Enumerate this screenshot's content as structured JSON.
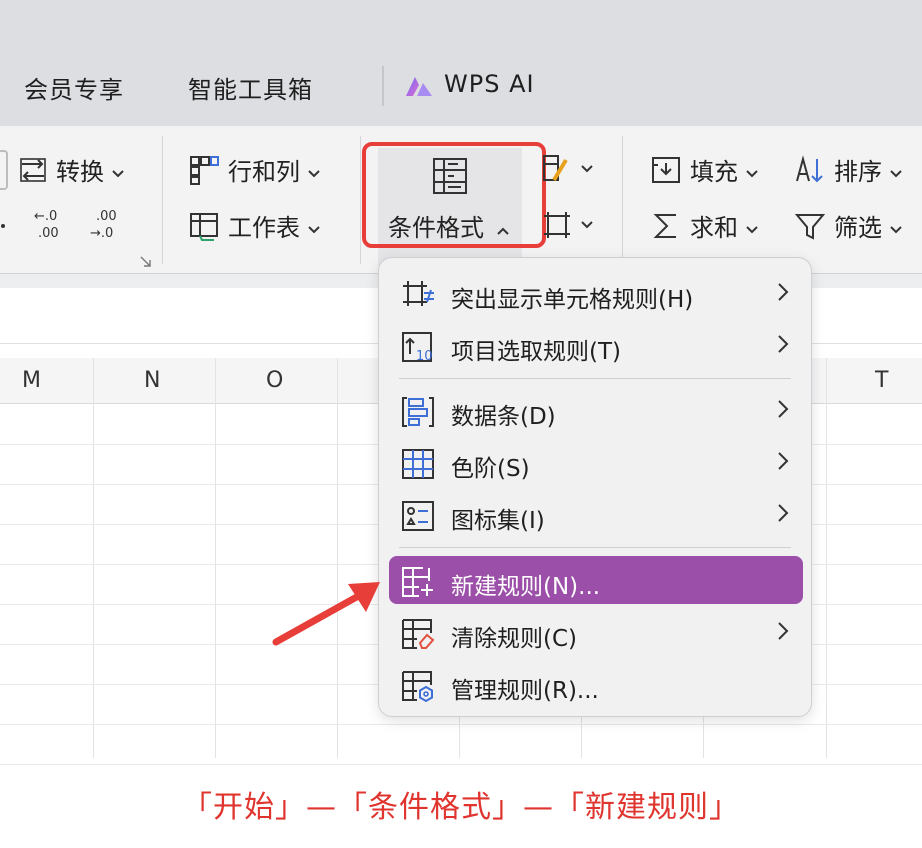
{
  "tabs": {
    "member": "会员专享",
    "smart_tools": "智能工具箱",
    "wps_ai": "WPS AI"
  },
  "ribbon": {
    "convert": "转换",
    "rows_cols": "行和列",
    "worksheet": "工作表",
    "cond_format": "条件格式",
    "fill": "填充",
    "sort": "排序",
    "sum": "求和",
    "filter": "筛选"
  },
  "columns": [
    "M",
    "N",
    "O",
    "T"
  ],
  "menu": {
    "highlight_rules": "突出显示单元格规则(H)",
    "top_rules": "项目选取规则(T)",
    "data_bars": "数据条(D)",
    "color_scales": "色阶(S)",
    "icon_sets": "图标集(I)",
    "new_rule": "新建规则(N)...",
    "clear_rules": "清除规则(C)",
    "manage_rules": "管理规则(R)..."
  },
  "caption": "「开始」—「条件格式」—「新建规则」",
  "colors": {
    "highlight_border": "#e83e3a",
    "active_item": "#9b4fa8",
    "caption": "#e0342f",
    "icon_blue": "#3d6fd6"
  }
}
